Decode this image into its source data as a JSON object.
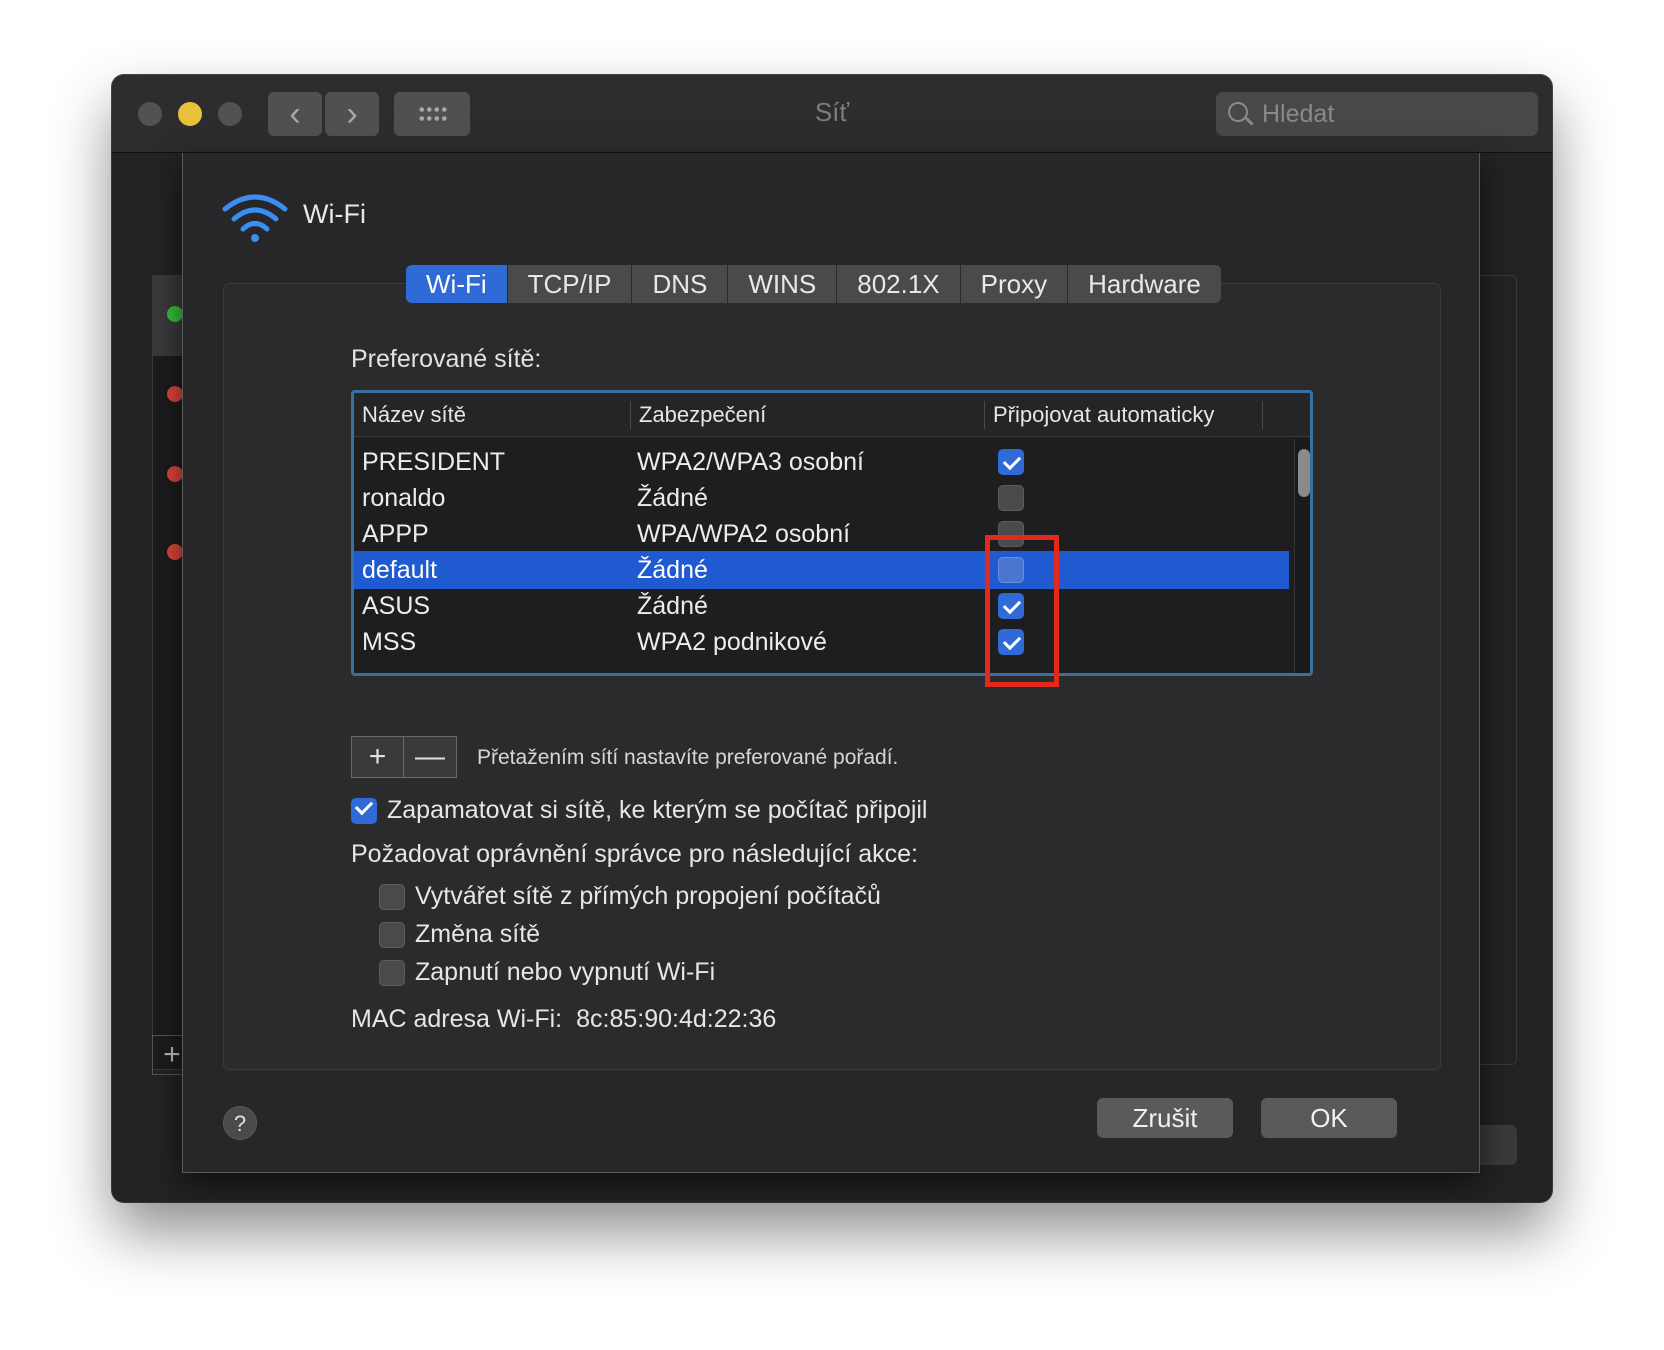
{
  "window": {
    "title": "Síť",
    "search_placeholder": "Hledat"
  },
  "toolbar": {
    "back_label": "‹",
    "forward_label": "›"
  },
  "sheet": {
    "title": "Wi-Fi"
  },
  "tabs": [
    {
      "label": "Wi-Fi",
      "active": true
    },
    {
      "label": "TCP/IP",
      "active": false
    },
    {
      "label": "DNS",
      "active": false
    },
    {
      "label": "WINS",
      "active": false
    },
    {
      "label": "802.1X",
      "active": false
    },
    {
      "label": "Proxy",
      "active": false
    },
    {
      "label": "Hardware",
      "active": false
    }
  ],
  "preferred": {
    "label": "Preferované sítě:",
    "columns": [
      "Název sítě",
      "Zabezpečení",
      "Připojovat automaticky"
    ],
    "rows": [
      {
        "name": "PRESIDENT",
        "security": "WPA2/WPA3 osobní",
        "auto": true,
        "selected": false
      },
      {
        "name": "ronaldo",
        "security": "Žádné",
        "auto": false,
        "selected": false
      },
      {
        "name": "APPP",
        "security": "WPA/WPA2 osobní",
        "auto": false,
        "selected": false
      },
      {
        "name": "default",
        "security": "Žádné",
        "auto": false,
        "selected": true
      },
      {
        "name": "ASUS",
        "security": "Žádné",
        "auto": true,
        "selected": false
      },
      {
        "name": "MSS",
        "security": "WPA2 podnikové",
        "auto": true,
        "selected": false
      }
    ],
    "add_label": "+",
    "remove_label": "—",
    "hint": "Přetažením sítí nastavíte preferované pořadí."
  },
  "options": {
    "remember": {
      "label": "Zapamatovat si sítě, ke kterým se počítač připojil",
      "checked": true
    },
    "admin_label": "Požadovat oprávnění správce pro následující akce:",
    "admin_items": [
      {
        "label": "Vytvářet sítě z přímých propojení počítačů",
        "checked": false
      },
      {
        "label": "Změna sítě",
        "checked": false
      },
      {
        "label": "Zapnutí nebo vypnutí Wi-Fi",
        "checked": false
      }
    ]
  },
  "mac": {
    "label": "MAC adresa Wi-Fi:",
    "value": "8c:85:90:4d:22:36"
  },
  "footer": {
    "help_label": "?",
    "cancel_label": "Zrušit",
    "ok_label": "OK"
  },
  "colors": {
    "accent": "#2f6ad6",
    "highlight": "#e1291c",
    "selection": "#1f5ad1"
  }
}
